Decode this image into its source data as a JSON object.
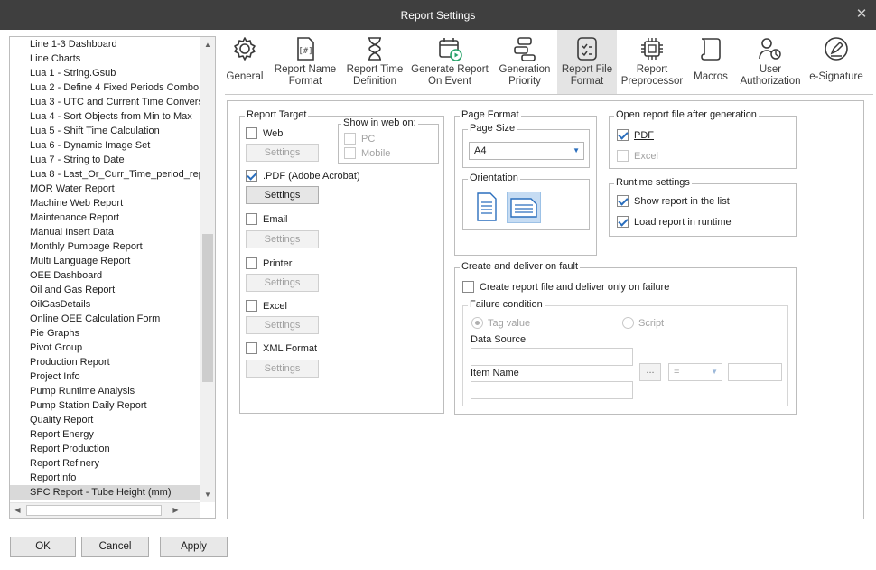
{
  "window": {
    "title": "Report Settings"
  },
  "report_list": {
    "items": [
      "Line 1-3 Dashboard",
      "Line Charts",
      "Lua 1 - String.Gsub",
      "Lua 2 - Define 4 Fixed Periods Combo",
      "Lua 3 - UTC and Current Time Conversi",
      "Lua 4 - Sort Objects from Min to Max",
      "Lua 5 - Shift Time Calculation",
      "Lua 6 - Dynamic Image Set",
      "Lua 7 - String to Date",
      "Lua 8 - Last_Or_Curr_Time_period_rep",
      "MOR Water Report",
      "Machine Web Report",
      "Maintenance Report",
      "Manual Insert Data",
      "Monthly Pumpage Report",
      "Multi Language Report",
      "OEE Dashboard",
      "Oil and Gas Report",
      "OilGasDetails",
      "Online OEE Calculation Form",
      "Pie Graphs",
      "Pivot Group",
      "Production Report",
      "Project Info",
      "Pump Runtime Analysis",
      "Pump Station Daily Report",
      "Quality Report",
      "Report Energy",
      "Report Production",
      "Report Refinery",
      "ReportInfo",
      "SPC Report - Tube Height (mm)"
    ],
    "selected": "SPC Report - Tube Height (mm)"
  },
  "toolbar": {
    "items": [
      {
        "label": "General",
        "icon": "gear-icon"
      },
      {
        "label": "Report Name Format",
        "icon": "name-format-icon"
      },
      {
        "label": "Report Time Definition",
        "icon": "hourglass-icon"
      },
      {
        "label": "Generate Report On Event",
        "icon": "calendar-play-icon"
      },
      {
        "label": "Generation Priority",
        "icon": "priority-icon"
      },
      {
        "label": "Report File Format",
        "icon": "file-format-icon"
      },
      {
        "label": "Report Preprocessor",
        "icon": "chip-icon"
      },
      {
        "label": "Macros",
        "icon": "scroll-icon"
      },
      {
        "label": "User Authorization",
        "icon": "users-icon"
      },
      {
        "label": "e-Signature",
        "icon": "signature-icon"
      }
    ],
    "active": "Report File Format"
  },
  "report_target": {
    "title": "Report Target",
    "show_in_web_title": "Show in web on:",
    "pc_label": "PC",
    "mobile_label": "Mobile",
    "targets": [
      {
        "label": "Web",
        "checked": false,
        "settings": "Settings"
      },
      {
        "label": ".PDF (Adobe Acrobat)",
        "checked": true,
        "settings": "Settings"
      },
      {
        "label": "Email",
        "checked": false,
        "settings": "Settings"
      },
      {
        "label": "Printer",
        "checked": false,
        "settings": "Settings"
      },
      {
        "label": "Excel",
        "checked": false,
        "settings": "Settings"
      },
      {
        "label": "XML Format",
        "checked": false,
        "settings": "Settings"
      }
    ]
  },
  "page_format": {
    "title": "Page Format",
    "page_size_title": "Page Size",
    "page_size_value": "A4",
    "orientation_title": "Orientation",
    "orientation_selected": "landscape"
  },
  "open_report": {
    "title": "Open report file after generation",
    "pdf_label": "PDF",
    "pdf_checked": true,
    "excel_label": "Excel",
    "excel_checked": false
  },
  "runtime": {
    "title": "Runtime settings",
    "show_in_list_label": "Show report in the list",
    "show_in_list_checked": true,
    "load_runtime_label": "Load report in runtime",
    "load_runtime_checked": true
  },
  "fault": {
    "title": "Create and deliver on fault",
    "create_only_label": "Create report file and deliver only on failure",
    "create_only_checked": false,
    "failure_condition_title": "Failure condition",
    "tag_value_label": "Tag value",
    "script_label": "Script",
    "data_source_label": "Data Source",
    "data_source_value": "",
    "item_name_label": "Item Name",
    "item_name_value": "",
    "browse_label": "...",
    "operator_value": "=",
    "compare_value": ""
  },
  "footer": {
    "ok": "OK",
    "cancel": "Cancel",
    "apply": "Apply"
  },
  "colors": {
    "titlebar": "#3f3f3f",
    "accent": "#2a6ebd",
    "active_tab": "#e4e4e4"
  }
}
